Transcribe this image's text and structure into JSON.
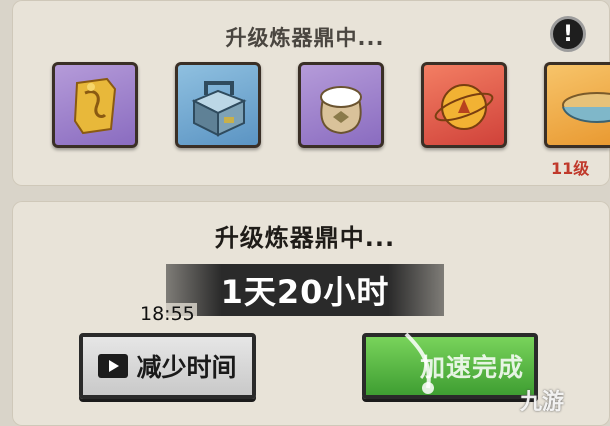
{
  "top_panel": {
    "title": "升级炼器鼎中...",
    "alert_symbol": "!",
    "items": [
      {
        "name": "golden-scroll",
        "icon": "golden-scroll-icon",
        "frame_color": "#8a6cc0"
      },
      {
        "name": "tech-box",
        "icon": "tech-box-icon",
        "frame_color": "#5b94c3"
      },
      {
        "name": "grain-sack",
        "icon": "grain-sack-icon",
        "frame_color": "#8a6cc0"
      },
      {
        "name": "golden-orb",
        "icon": "golden-orb-icon",
        "frame_color": "#d0423a"
      },
      {
        "name": "soup-bowl",
        "icon": "soup-bowl-icon",
        "frame_color": "#e99a32"
      }
    ],
    "level_label": "11级"
  },
  "bottom_panel": {
    "title": "升级炼器鼎中...",
    "timer": "1天20小时",
    "clock": "18:55",
    "reduce_time_label": "减少时间",
    "speed_up_label": "加速完成",
    "speed_up_label_visible": "加速完成"
  },
  "watermark": "九游",
  "colors": {
    "panel_bg": "#e8e3d8",
    "level_red": "#c0392b",
    "green_button": "#3f9e32",
    "timer_bar": "#2a2a2a"
  }
}
